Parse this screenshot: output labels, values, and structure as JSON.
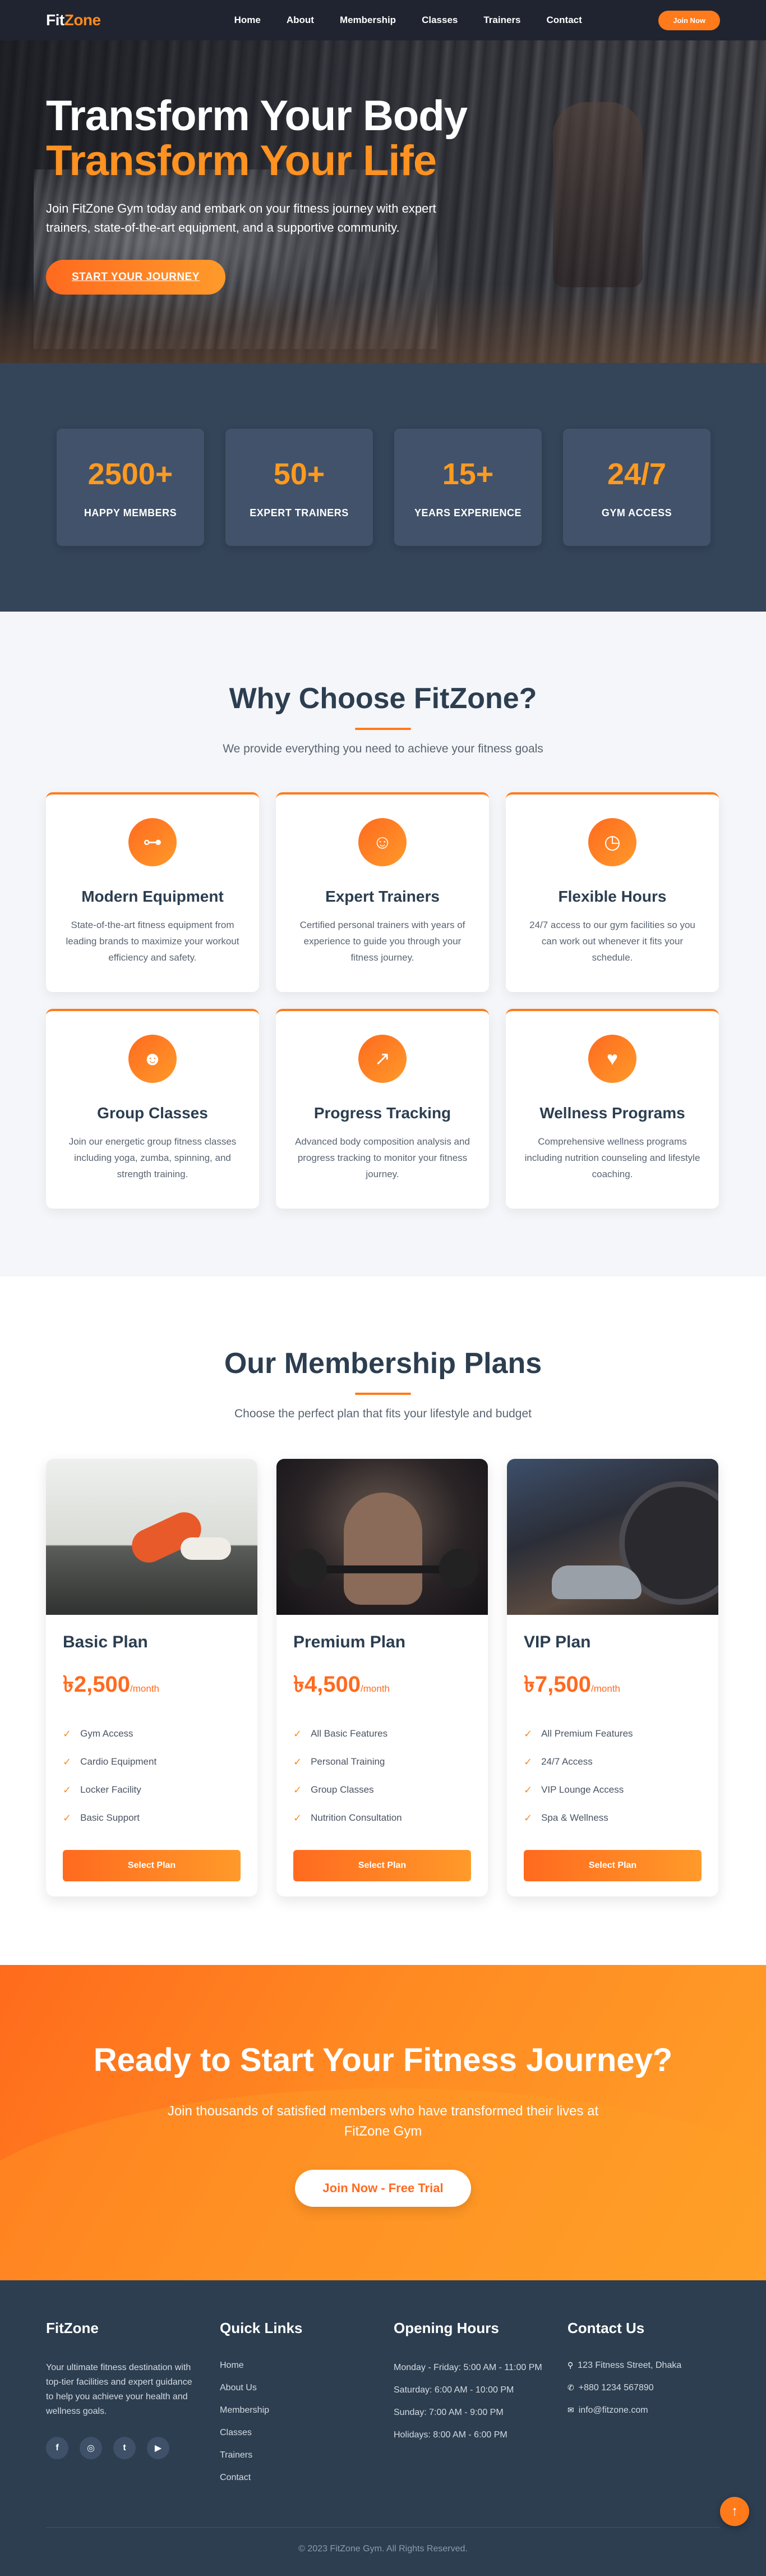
{
  "nav": {
    "logo_fit": "Fit",
    "logo_zone": "Zone",
    "links": [
      "Home",
      "About",
      "Membership",
      "Classes",
      "Trainers",
      "Contact"
    ],
    "cta": "Join Now"
  },
  "hero": {
    "title1": "Transform Your Body",
    "title2": "Transform Your Life",
    "text": "Join FitZone Gym today and embark on your fitness journey with expert trainers, state-of-the-art equipment, and a supportive community.",
    "button": "START YOUR JOURNEY"
  },
  "stats": [
    {
      "num": "2500+",
      "label": "HAPPY MEMBERS"
    },
    {
      "num": "50+",
      "label": "EXPERT TRAINERS"
    },
    {
      "num": "15+",
      "label": "YEARS EXPERIENCE"
    },
    {
      "num": "24/7",
      "label": "GYM ACCESS"
    }
  ],
  "why": {
    "title": "Why Choose FitZone?",
    "subtitle": "We provide everything you need to achieve your fitness goals",
    "features": [
      {
        "icon": "dumbbell-icon",
        "glyph": "⊶",
        "title": "Modern Equipment",
        "desc": "State-of-the-art fitness equipment from leading brands to maximize your workout efficiency and safety."
      },
      {
        "icon": "trainer-icon",
        "glyph": "☺",
        "title": "Expert Trainers",
        "desc": "Certified personal trainers with years of experience to guide you through your fitness journey."
      },
      {
        "icon": "clock-icon",
        "glyph": "◷",
        "title": "Flexible Hours",
        "desc": "24/7 access to our gym facilities so you can work out whenever it fits your schedule."
      },
      {
        "icon": "group-icon",
        "glyph": "☻",
        "title": "Group Classes",
        "desc": "Join our energetic group fitness classes including yoga, zumba, spinning, and strength training."
      },
      {
        "icon": "chart-icon",
        "glyph": "↗",
        "title": "Progress Tracking",
        "desc": "Advanced body composition analysis and progress tracking to monitor your fitness journey."
      },
      {
        "icon": "heart-icon",
        "glyph": "♥",
        "title": "Wellness Programs",
        "desc": "Comprehensive wellness programs including nutrition counseling and lifestyle coaching."
      }
    ]
  },
  "plans": {
    "title": "Our Membership Plans",
    "subtitle": "Choose the perfect plan that fits your lifestyle and budget",
    "items": [
      {
        "name": "Basic Plan",
        "price": "৳2,500",
        "per": "/month",
        "features": [
          "Gym Access",
          "Cardio Equipment",
          "Locker Facility",
          "Basic Support"
        ],
        "button": "Select Plan"
      },
      {
        "name": "Premium Plan",
        "price": "৳4,500",
        "per": "/month",
        "features": [
          "All Basic Features",
          "Personal Training",
          "Group Classes",
          "Nutrition Consultation"
        ],
        "button": "Select Plan"
      },
      {
        "name": "VIP Plan",
        "price": "৳7,500",
        "per": "/month",
        "features": [
          "All Premium Features",
          "24/7 Access",
          "VIP Lounge Access",
          "Spa & Wellness"
        ],
        "button": "Select Plan"
      }
    ]
  },
  "cta": {
    "title": "Ready to Start Your Fitness Journey?",
    "text": "Join thousands of satisfied members who have transformed their lives at FitZone Gym",
    "button": "Join Now - Free Trial"
  },
  "footer": {
    "about_title": "FitZone",
    "about_text": "Your ultimate fitness destination with top-tier facilities and expert guidance to help you achieve your health and wellness goals.",
    "socials": [
      "f",
      "◎",
      "t",
      "▶"
    ],
    "links_title": "Quick Links",
    "links": [
      "Home",
      "About Us",
      "Membership",
      "Classes",
      "Trainers",
      "Contact"
    ],
    "hours_title": "Opening Hours",
    "hours": [
      "Monday - Friday: 5:00 AM - 11:00 PM",
      "Saturday: 6:00 AM - 10:00 PM",
      "Sunday: 7:00 AM - 9:00 PM",
      "Holidays: 8:00 AM - 6:00 PM"
    ],
    "contact_title": "Contact Us",
    "contact": [
      {
        "icon": "⚲",
        "text": "123 Fitness Street, Dhaka"
      },
      {
        "icon": "✆",
        "text": "+880 1234 567890"
      },
      {
        "icon": "✉",
        "text": "info@fitzone.com"
      }
    ],
    "copyright": "© 2023 FitZone Gym. All Rights Reserved."
  },
  "colors": {
    "accent": "#ff7a1a",
    "dark": "#2c3e50",
    "stats_bg": "#344459"
  }
}
